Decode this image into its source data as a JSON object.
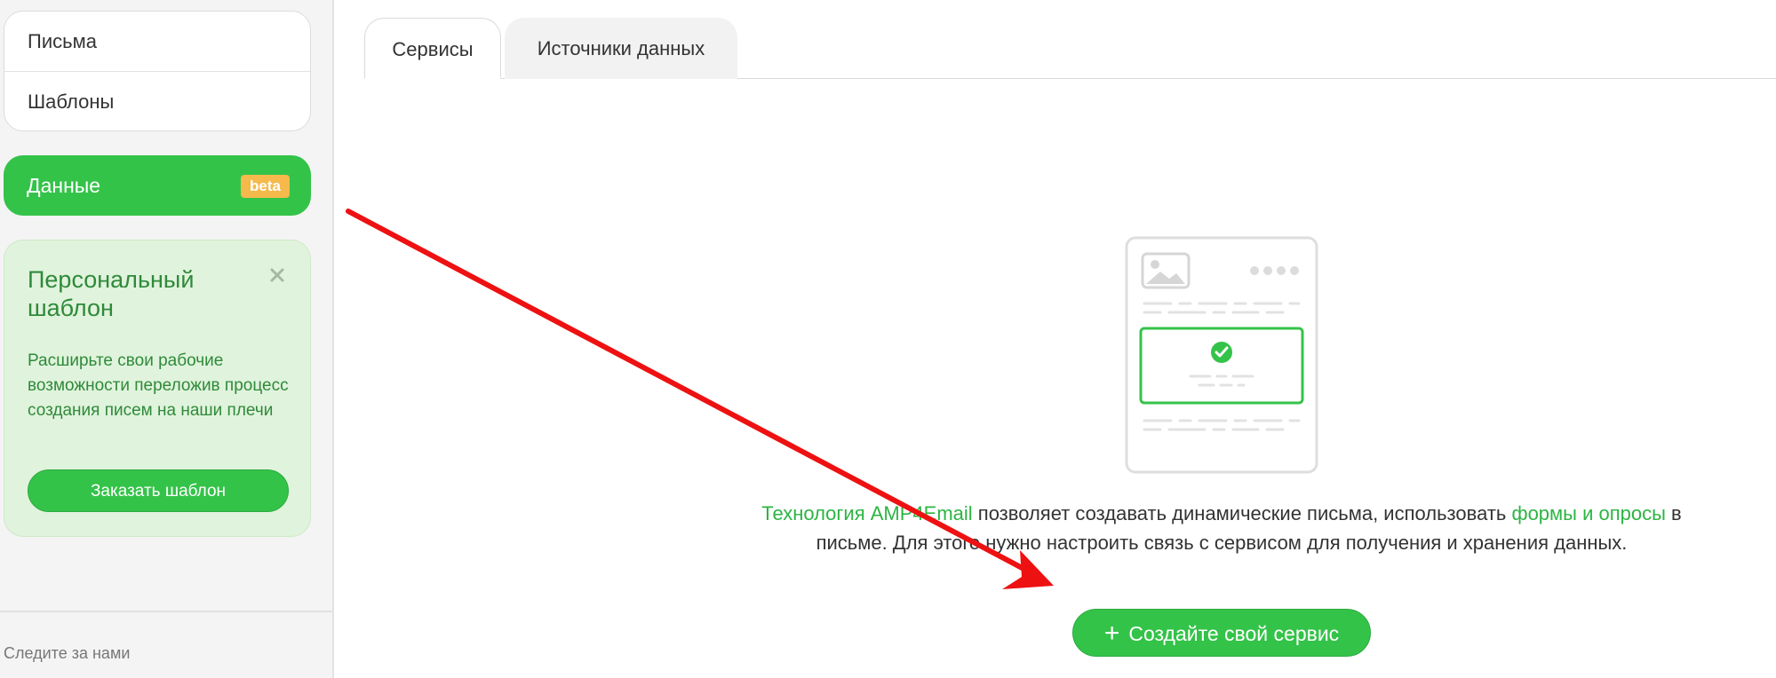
{
  "sidebar": {
    "nav_items": [
      {
        "label": "Письма"
      },
      {
        "label": "Шаблоны"
      }
    ],
    "active_item": {
      "label": "Данные",
      "badge": "beta"
    },
    "promo": {
      "title": "Персональный шаблон",
      "text": "Расширьте свои рабочие возможности переложив процесс создания писем на наши плечи",
      "button_label": "Заказать шаблон",
      "close_icon": "close-icon"
    },
    "footer_link": "Следите за нами"
  },
  "tabs": [
    {
      "label": "Сервисы",
      "active": true
    },
    {
      "label": "Источники данных",
      "active": false
    }
  ],
  "main": {
    "illustration": "email-template-illustration",
    "description": {
      "link1": "Технология AMP4Email",
      "text1": " позволяет создавать динамические письма, использовать ",
      "link2": "формы и опросы",
      "text2": " в письме. Для этого нужно настроить связь с сервисом для получения и хранения данных."
    },
    "create_button": {
      "icon": "+",
      "label": "Создайте свой сервис"
    }
  },
  "colors": {
    "accent_green": "#34c349",
    "link_green": "#2db443",
    "promo_bg": "#e0f3dc",
    "badge_orange": "#f5b94c",
    "annotation_arrow": "#ee1111"
  }
}
